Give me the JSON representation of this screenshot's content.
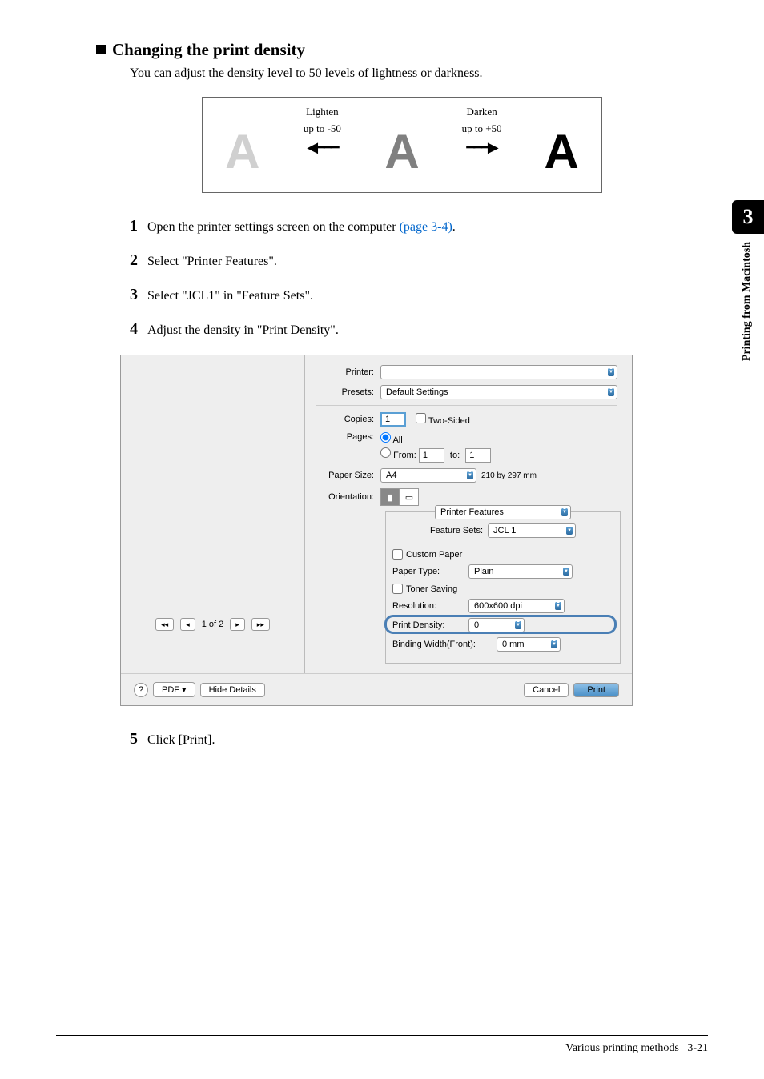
{
  "section": {
    "title": "Changing the print density",
    "intro": "You can adjust the density level to 50 levels of lightness or darkness."
  },
  "density_demo": {
    "lighten_label1": "Lighten",
    "lighten_label2": "up to -50",
    "darken_label1": "Darken",
    "darken_label2": "up to +50",
    "glyph": "A"
  },
  "steps": {
    "s1_a": "Open the printer settings screen on the computer ",
    "s1_link": "(page 3-4)",
    "s1_b": ".",
    "s2": "Select \"Printer Features\".",
    "s3": "Select \"JCL1\" in \"Feature Sets\".",
    "s4": "Adjust the density in \"Print Density\".",
    "s5": "Click [Print]."
  },
  "dialog": {
    "printer_label": "Printer:",
    "printer_value": " ",
    "presets_label": "Presets:",
    "presets_value": "Default Settings",
    "copies_label": "Copies:",
    "copies_value": "1",
    "two_sided": "Two-Sided",
    "pages_label": "Pages:",
    "pages_all": "All",
    "pages_from": "From:",
    "pages_from_val": "1",
    "pages_to": "to:",
    "pages_to_val": "1",
    "paper_size_label": "Paper Size:",
    "paper_size_value": "A4",
    "paper_size_dims": "210 by 297 mm",
    "orientation_label": "Orientation:",
    "features_value": "Printer Features",
    "feature_sets_label": "Feature Sets:",
    "feature_sets_value": "JCL 1",
    "custom_paper": "Custom Paper",
    "paper_type_label": "Paper Type:",
    "paper_type_value": "Plain",
    "toner_saving": "Toner Saving",
    "resolution_label": "Resolution:",
    "resolution_value": "600x600 dpi",
    "print_density_label": "Print Density:",
    "print_density_value": "0",
    "binding_label": "Binding Width(Front):",
    "binding_value": "0 mm",
    "page_nav": "1 of 2",
    "help": "?",
    "pdf_btn": "PDF",
    "hide_details": "Hide Details",
    "cancel": "Cancel",
    "print": "Print"
  },
  "side": {
    "chapter": "3",
    "label": "Printing from Macintosh"
  },
  "footer": {
    "text": "Various printing methods",
    "page": "3-21"
  }
}
